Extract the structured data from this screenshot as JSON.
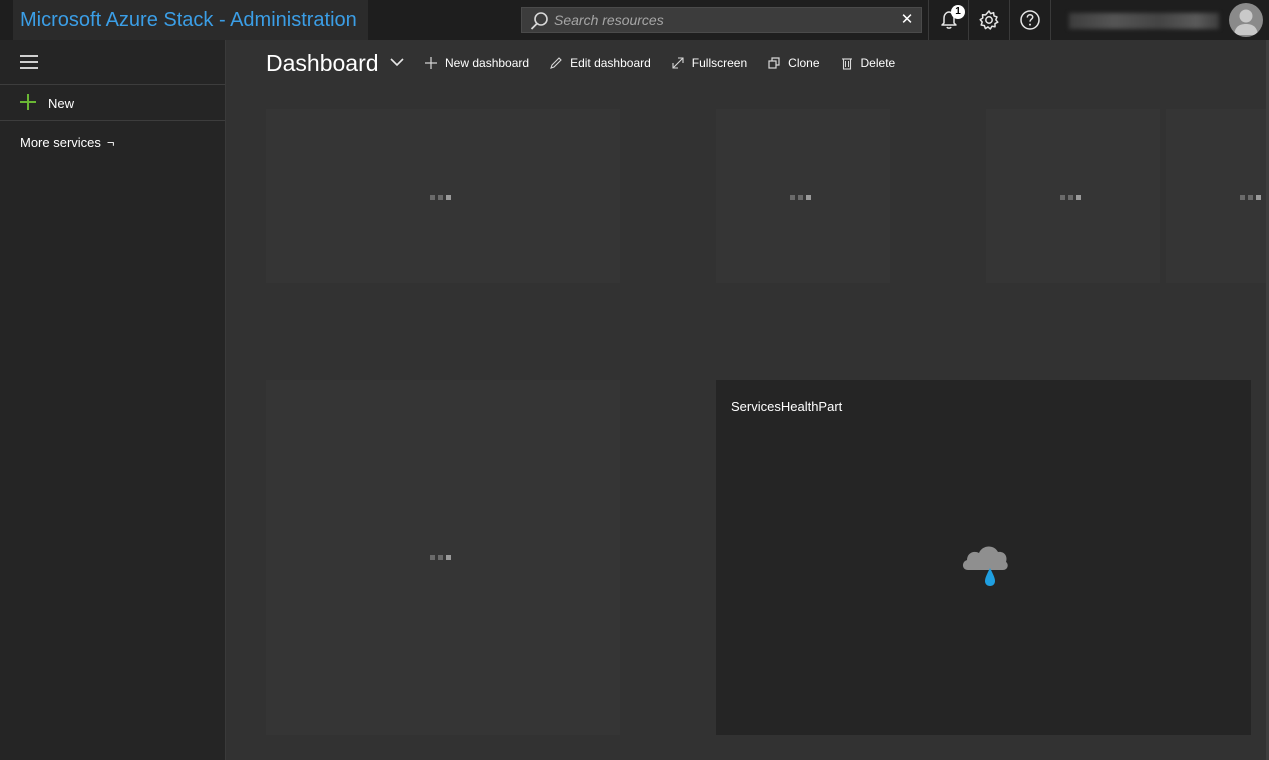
{
  "app": {
    "title": "Microsoft Azure Stack - Administration"
  },
  "search": {
    "placeholder": "Search resources",
    "value": ""
  },
  "notifications": {
    "count": "1"
  },
  "sidebar": {
    "new_label": "New",
    "more_services_label": "More services",
    "more_services_chevron": "¬"
  },
  "dashboard": {
    "title": "Dashboard",
    "toolbar": {
      "new_dashboard": "New dashboard",
      "edit_dashboard": "Edit dashboard",
      "fullscreen": "Fullscreen",
      "clone": "Clone",
      "delete": "Delete"
    }
  },
  "tiles": {
    "health_title": "ServicesHealthPart"
  },
  "colors": {
    "brand": "#3b9ee6",
    "accent_green": "#6ab734",
    "rain_blue": "#1f9fe0"
  },
  "icons": {
    "search": "search-icon",
    "clear": "clear-icon",
    "bell": "bell-icon",
    "settings": "gear-icon",
    "help": "help-icon",
    "avatar": "avatar-icon",
    "menu": "hamburger-icon",
    "new": "plus-icon",
    "loading": "loading-dots-icon",
    "health": "cloud-rain-icon"
  }
}
